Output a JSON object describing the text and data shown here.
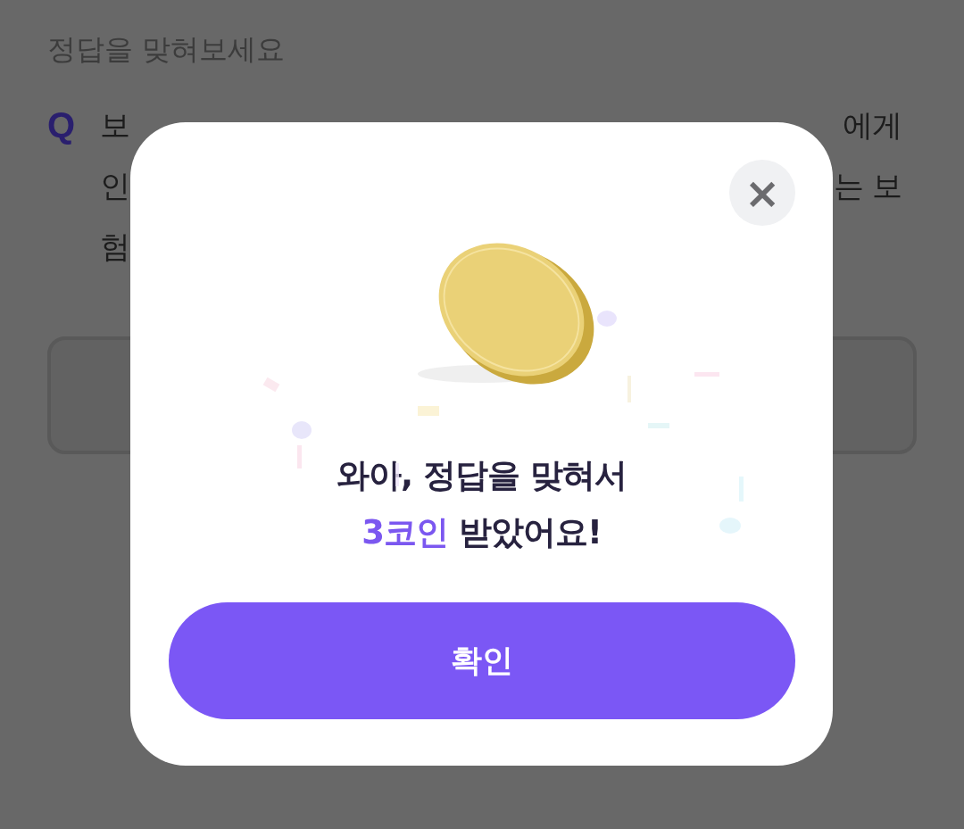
{
  "page": {
    "heading": "정답을 맞혀보세요",
    "question": {
      "marker": "Q",
      "lines": [
        [
          "보",
          "에게"
        ],
        [
          "인",
          "는 보"
        ],
        [
          "험"
        ]
      ]
    }
  },
  "dialog": {
    "close": "×",
    "title": "와아, 정답을 맞혀서",
    "reward": {
      "amount": "3코인",
      "rest": "받았어요!"
    },
    "button": "확인"
  }
}
